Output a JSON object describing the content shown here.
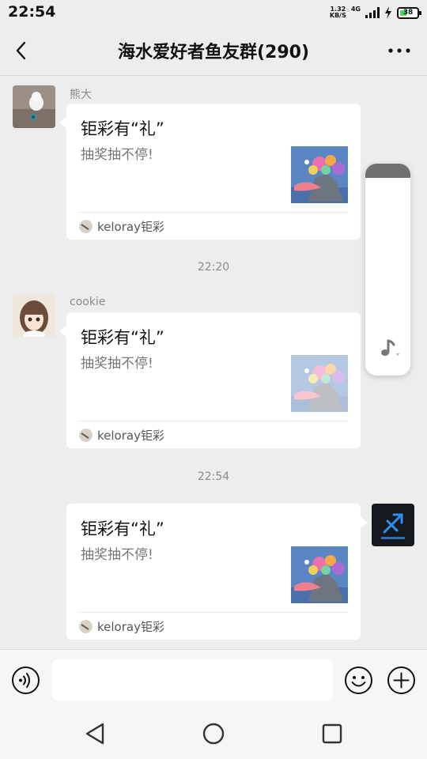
{
  "status_bar": {
    "time": "22:54",
    "net_speed_value": "1.32",
    "net_speed_unit": "KB/S",
    "network_type": "4G",
    "battery": "38"
  },
  "header": {
    "title": "海水爱好者鱼友群(290)",
    "back_icon": "back-chevron-icon",
    "more_icon": "more-dots-icon"
  },
  "messages": [
    {
      "sender": "熊大",
      "title": "钜彩有“礼”",
      "desc": "抽奖抽不停!",
      "source": "keloray钜彩"
    },
    {
      "timestamp": "22:20",
      "sender": "cookie",
      "title": "钜彩有“礼”",
      "desc": "抽奖抽不停!",
      "source": "keloray钜彩"
    },
    {
      "timestamp": "22:54",
      "title": "钜彩有“礼”",
      "desc": "抽奖抽不停!",
      "source": "keloray钜彩"
    }
  ],
  "input_bar": {
    "placeholder": "",
    "voice_icon": "voice-icon",
    "emoji_icon": "emoji-icon",
    "plus_icon": "plus-icon"
  },
  "colors": {
    "background": "#ededed",
    "card": "#ffffff",
    "muted_text": "#8a8a8a",
    "battery_fill": "#4cd964"
  }
}
